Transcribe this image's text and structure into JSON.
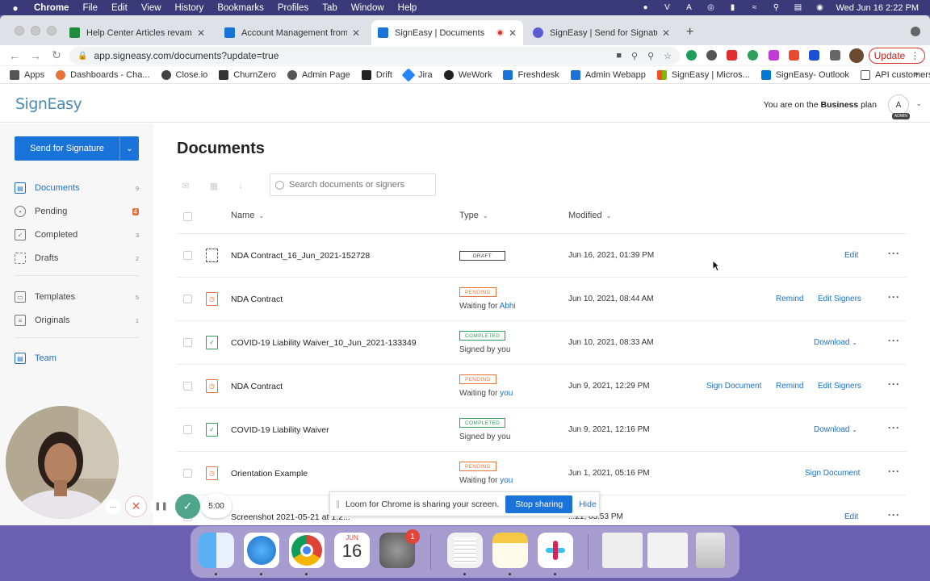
{
  "menubar": {
    "app": "Chrome",
    "items": [
      "File",
      "Edit",
      "View",
      "History",
      "Bookmarks",
      "Profiles",
      "Tab",
      "Window",
      "Help"
    ],
    "clock": "Wed Jun 16  2:22 PM"
  },
  "tabs": [
    {
      "title": "Help Center Articles revamp p",
      "favicon_color": "#1e8e3e"
    },
    {
      "title": "Account Management from the",
      "favicon_color": "#1a73d9"
    },
    {
      "title": "SignEasy | Documents",
      "favicon_color": "#1a73d9"
    },
    {
      "title": "SignEasy | Send for Signature",
      "favicon_color": "#5b5bd6"
    }
  ],
  "address_bar": {
    "url": "app.signeasy.com/documents?update=true",
    "update_label": "Update"
  },
  "bookmarks": [
    {
      "label": "Apps",
      "color": "#555"
    },
    {
      "label": "Dashboards - Cha...",
      "color": "#e8733a"
    },
    {
      "label": "Close.io",
      "color": "#444"
    },
    {
      "label": "ChurnZero",
      "color": "#333"
    },
    {
      "label": "Admin Page",
      "color": "#555"
    },
    {
      "label": "Drift",
      "color": "#222"
    },
    {
      "label": "Jira",
      "color": "#2684ff"
    },
    {
      "label": "WeWork",
      "color": "#222"
    },
    {
      "label": "Freshdesk",
      "color": "#1a73d9"
    },
    {
      "label": "Admin Webapp",
      "color": "#1a73d9"
    },
    {
      "label": "SignEasy | Micros...",
      "color": "#f25022"
    },
    {
      "label": "SignEasy- Outlook",
      "color": "#0078d4"
    },
    {
      "label": "API customers",
      "color": "#555"
    }
  ],
  "header": {
    "logo": "SignEasy",
    "plan_prefix": "You are on the ",
    "plan_name": "Business",
    "plan_suffix": " plan",
    "avatar_letter": "A",
    "admin_badge": "ADMIN"
  },
  "sidebar": {
    "send_button": "Send for Signature",
    "items": [
      {
        "label": "Documents",
        "count": "9"
      },
      {
        "label": "Pending",
        "count": "4"
      },
      {
        "label": "Completed",
        "count": "3"
      },
      {
        "label": "Drafts",
        "count": "2"
      },
      {
        "label": "Templates",
        "count": "5"
      },
      {
        "label": "Originals",
        "count": "1"
      },
      {
        "label": "Team",
        "count": ""
      }
    ]
  },
  "main": {
    "title": "Documents",
    "search_placeholder": "Search documents or signers",
    "columns": {
      "name": "Name",
      "type": "Type",
      "modified": "Modified"
    }
  },
  "documents": [
    {
      "name": "NDA Contract_16_Jun_2021-152728",
      "status": "DRAFT",
      "sub_prefix": "",
      "sub_who": "",
      "modified": "Jun 16, 2021, 01:39 PM",
      "actions": [
        "Edit"
      ]
    },
    {
      "name": "NDA Contract",
      "status": "PENDING",
      "sub_prefix": "Waiting for ",
      "sub_who": "Abhi",
      "modified": "Jun 10, 2021, 08:44 AM",
      "actions": [
        "Remind",
        "Edit Signers"
      ]
    },
    {
      "name": "COVID-19 Liability Waiver_10_Jun_2021-133349",
      "status": "COMPLETED",
      "sub_prefix": "Signed by you",
      "sub_who": "",
      "modified": "Jun 10, 2021, 08:33 AM",
      "actions": [
        "Download"
      ]
    },
    {
      "name": "NDA Contract",
      "status": "PENDING",
      "sub_prefix": "Waiting for ",
      "sub_who": "you",
      "modified": "Jun 9, 2021, 12:29 PM",
      "actions": [
        "Sign Document",
        "Remind",
        "Edit Signers"
      ]
    },
    {
      "name": "COVID-19 Liability Waiver",
      "status": "COMPLETED",
      "sub_prefix": "Signed by you",
      "sub_who": "",
      "modified": "Jun 9, 2021, 12:16 PM",
      "actions": [
        "Download"
      ]
    },
    {
      "name": "Orientation Example",
      "status": "PENDING",
      "sub_prefix": "Waiting for ",
      "sub_who": "you",
      "modified": "Jun 1, 2021, 05:16 PM",
      "actions": [
        "Sign Document"
      ]
    },
    {
      "name": "Screenshot 2021-05-21 at 1:2...",
      "status": "",
      "sub_prefix": "",
      "sub_who": "",
      "modified": "...21, 03:53 PM",
      "actions": [
        "Edit"
      ]
    }
  ],
  "loom": {
    "message": "Loom for Chrome is sharing your screen.",
    "stop_label": "Stop sharing",
    "hide_label": "Hide",
    "timer": "5:00"
  },
  "dock": {
    "calendar_month": "JUN",
    "calendar_day": "16",
    "settings_badge": "1"
  }
}
